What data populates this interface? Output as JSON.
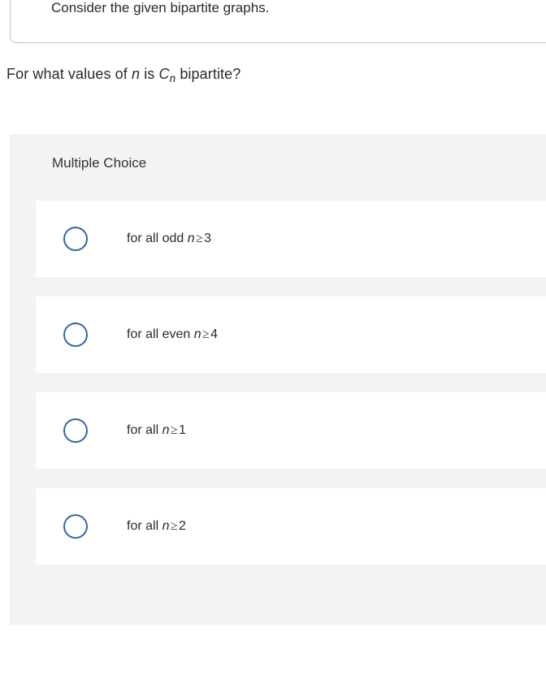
{
  "prompt": "Consider the given bipartite graphs.",
  "question": {
    "prefix": "For what values of ",
    "var": "n",
    "mid": " is ",
    "sym_base": "C",
    "sym_sub": "n",
    "suffix": " bipartite?"
  },
  "mc_header": "Multiple Choice",
  "options": [
    {
      "prefix": "for all odd ",
      "var": "n",
      "op": "≥",
      "num": "3"
    },
    {
      "prefix": "for all even ",
      "var": "n",
      "op": "≥",
      "num": "4"
    },
    {
      "prefix": "for all ",
      "var": "n",
      "op": "≥",
      "num": "1"
    },
    {
      "prefix": "for all ",
      "var": "n",
      "op": "≥",
      "num": "2"
    }
  ]
}
